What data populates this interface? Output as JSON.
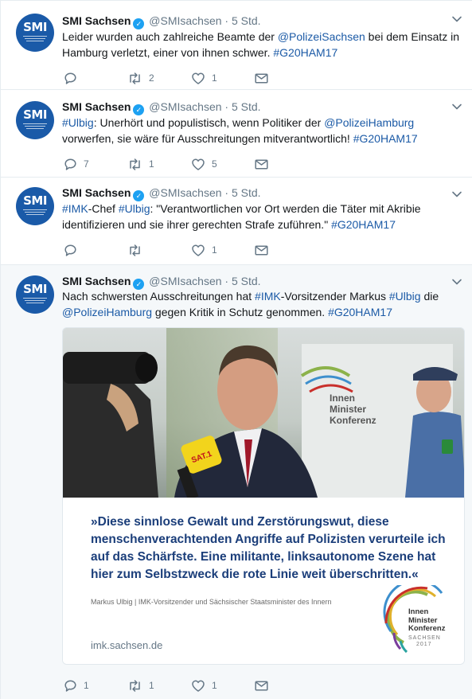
{
  "tweets": [
    {
      "account": {
        "name": "SMI Sachsen",
        "handle": "@SMIsachsen",
        "avatar_letters": "SMI"
      },
      "time": "5 Std.",
      "segments": [
        {
          "t": "Leider wurden auch zahlreiche Beamte der "
        },
        {
          "t": "@PolizeiSachsen",
          "link": true
        },
        {
          "t": " bei dem Einsatz in Hamburg verletzt, einer von ihnen schwer. "
        },
        {
          "t": "#G20HAM17",
          "link": true
        }
      ],
      "replies": "",
      "retweets": "2",
      "likes": "1"
    },
    {
      "account": {
        "name": "SMI Sachsen",
        "handle": "@SMIsachsen",
        "avatar_letters": "SMI"
      },
      "time": "5 Std.",
      "segments": [
        {
          "t": "#Ulbig",
          "link": true
        },
        {
          "t": ": Unerhört und populistisch, wenn Politiker der "
        },
        {
          "t": "@PolizeiHamburg",
          "link": true
        },
        {
          "t": " vorwerfen, sie wäre für Ausschreitungen mitverantwortlich! "
        },
        {
          "t": "#G20HAM17",
          "link": true
        }
      ],
      "replies": "7",
      "retweets": "1",
      "likes": "5"
    },
    {
      "account": {
        "name": "SMI Sachsen",
        "handle": "@SMIsachsen",
        "avatar_letters": "SMI"
      },
      "time": "5 Std.",
      "segments": [
        {
          "t": "#IMK",
          "link": true
        },
        {
          "t": "-Chef "
        },
        {
          "t": "#Ulbig",
          "link": true
        },
        {
          "t": ": \"Verantwortlichen vor Ort werden die Täter mit Akribie identifizieren und sie ihrer gerechten Strafe zuführen.\" "
        },
        {
          "t": "#G20HAM17",
          "link": true
        }
      ],
      "replies": "",
      "retweets": "",
      "likes": "1"
    },
    {
      "account": {
        "name": "SMI Sachsen",
        "handle": "@SMIsachsen",
        "avatar_letters": "SMI"
      },
      "time": "5 Std.",
      "segments": [
        {
          "t": "Nach schwersten Ausschreitungen hat "
        },
        {
          "t": "#IMK",
          "link": true
        },
        {
          "t": "-Vorsitzender Markus "
        },
        {
          "t": "#Ulbig",
          "link": true
        },
        {
          "t": " die "
        },
        {
          "t": "@PolizeiHamburg",
          "link": true
        },
        {
          "t": " gegen Kritik in Schutz genommen. "
        },
        {
          "t": "#G20HAM17",
          "link": true
        }
      ],
      "replies": "1",
      "retweets": "1",
      "likes": "1"
    }
  ],
  "card": {
    "quote": "»Diese sinnlose Gewalt und Zerstörungswut, diese menschenverachtenden Angriffe auf Polizisten verurteile ich auf das Schärfste. Eine militante, linksautonome Szene hat hier zum Selbstzweck die rote Linie weit überschritten.«",
    "attribution": "Markus Ulbig | IMK-Vorsitzender und Sächsischer Staatsminister des Innern",
    "domain": "imk.sachsen.de",
    "logo_line1": "Innen",
    "logo_line2": "Minister",
    "logo_line3": "Konferenz",
    "logo_sub1": "SACHSEN",
    "logo_sub2": "2017",
    "photo_mic_text": "SAT.1"
  },
  "icons": [
    "reply-icon",
    "retweet-icon",
    "like-icon",
    "direct-message-icon",
    "chevron-down-icon",
    "verified-icon"
  ],
  "colors": {
    "link": "#1b5aa6",
    "meta": "#657786",
    "verified": "#1da1f2",
    "avatar": "#1a5aa8",
    "quote": "#1b3e7a"
  }
}
